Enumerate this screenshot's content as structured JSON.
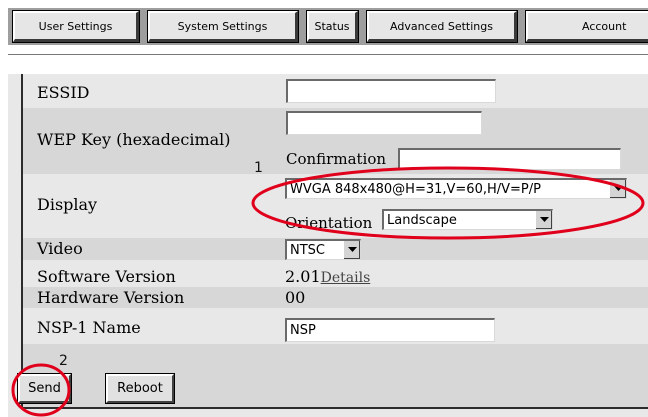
{
  "tabs": [
    {
      "label": "User Settings"
    },
    {
      "label": "System Settings"
    },
    {
      "label": "Status"
    },
    {
      "label": "Advanced Settings"
    },
    {
      "label": "Account"
    }
  ],
  "form": {
    "essid": {
      "label": "ESSID",
      "value": ""
    },
    "wep": {
      "label": "WEP Key (hexadecimal)",
      "value": "",
      "confirmation_label": "Confirmation",
      "confirmation_value": ""
    },
    "display": {
      "label": "Display",
      "value": "WVGA 848x480@H=31,V=60,H/V=P/P",
      "orientation_label": "Orientation",
      "orientation_value": "Landscape"
    },
    "video": {
      "label": "Video",
      "value": "NTSC"
    },
    "software": {
      "label": "Software Version",
      "value": "2.01",
      "details_link": "Details"
    },
    "hardware": {
      "label": "Hardware Version",
      "value": "00"
    },
    "nsp_name": {
      "label": "NSP-1 Name",
      "value": "NSP"
    }
  },
  "buttons": {
    "send": "Send",
    "reboot": "Reboot"
  },
  "annotations": {
    "marker_1": "1",
    "marker_2": "2",
    "ring_color": "#e0001b"
  }
}
